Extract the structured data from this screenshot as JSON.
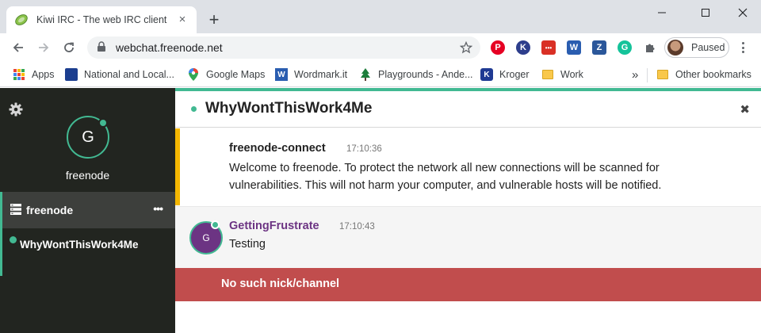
{
  "browser": {
    "tab": {
      "title": "Kiwi IRC - The web IRC client",
      "close": "×"
    },
    "new_tab": "+",
    "window": {
      "minimize": "minimize-icon",
      "maximize": "maximize-icon",
      "close": "close-icon"
    },
    "address": {
      "url": "webchat.freenode.net"
    },
    "extensions": [
      {
        "name": "pinterest",
        "color": "#e60023",
        "glyph": "P"
      },
      {
        "name": "k",
        "color": "#2d3e8c",
        "glyph": "K"
      },
      {
        "name": "dots",
        "color": "#d93025",
        "glyph": "•••"
      },
      {
        "name": "w",
        "color": "#2a5db0",
        "glyph": "W"
      },
      {
        "name": "z",
        "color": "#2b579a",
        "glyph": "Z"
      },
      {
        "name": "grammarly",
        "color": "#15c39a",
        "glyph": "G"
      }
    ],
    "profile": {
      "label": "Paused"
    },
    "bookmarks": [
      {
        "label": "Apps"
      },
      {
        "label": "National and Local..."
      },
      {
        "label": "Google Maps"
      },
      {
        "label": "Wordmark.it"
      },
      {
        "label": "Playgrounds - Ande..."
      },
      {
        "label": "Kroger"
      },
      {
        "label": "Work"
      }
    ],
    "bookmarks_overflow": "»",
    "other_bookmarks": "Other bookmarks"
  },
  "kiwi": {
    "accent": "#42b992",
    "network": {
      "avatar_letter": "G",
      "name": "freenode",
      "row_label": "freenode",
      "row_menu": "•••"
    },
    "channel": {
      "name": "WhyWontThisWork4Me"
    },
    "header": {
      "title": "WhyWontThisWork4Me",
      "close": "✖"
    },
    "messages": [
      {
        "nick": "freenode-connect",
        "time": "17:10:36",
        "text": "Welcome to freenode. To protect the network all new connections will be scanned for vulnerabilities. This will not harm your computer, and vulnerable hosts will be notified."
      },
      {
        "nick": "GettingFrustrate",
        "avatar_letter": "G",
        "time": "17:10:43",
        "text": "Testing"
      }
    ],
    "error": "No such nick/channel"
  }
}
